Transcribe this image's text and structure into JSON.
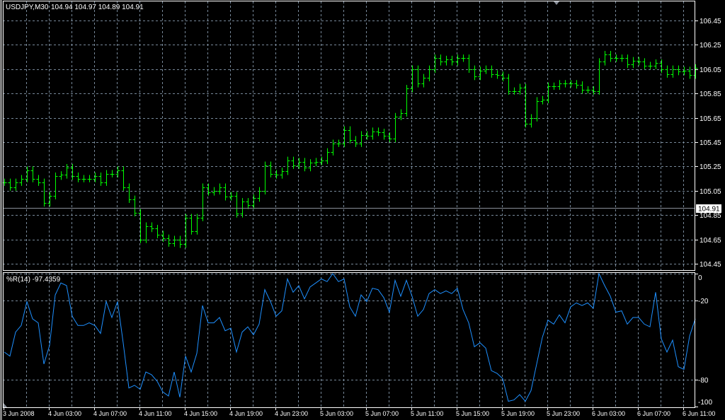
{
  "header": {
    "symbol": "USDJPY,M30",
    "ohlc": "104.94 104.97 104.89 104.91"
  },
  "colors": {
    "background": "#000000",
    "bars": "#00ff00",
    "indicator_line": "#1e90ff",
    "grid": "#778899",
    "frame": "#ffffff"
  },
  "chart_data": [
    {
      "type": "ohlc-bar",
      "title": "USDJPY,M30",
      "current_price_label": "104.91",
      "current_price": 104.91,
      "ylim": [
        104.39,
        106.61
      ],
      "y_ticks": [
        "106.45",
        "106.25",
        "106.05",
        "105.85",
        "105.65",
        "105.45",
        "105.25",
        "105.05",
        "104.85",
        "104.65",
        "104.45"
      ],
      "x_tick_labels": [
        "3 Jun 2008",
        "4 Jun 03:00",
        "4 Jun 07:00",
        "4 Jun 11:00",
        "4 Jun 15:00",
        "4 Jun 19:00",
        "4 Jun 23:00",
        "5 Jun 03:00",
        "5 Jun 07:00",
        "5 Jun 11:00",
        "5 Jun 15:00",
        "5 Jun 19:00",
        "5 Jun 23:00",
        "6 Jun 03:00",
        "6 Jun 07:00",
        "6 Jun 11:00"
      ],
      "grid": true,
      "close": [
        105.12,
        105.08,
        105.12,
        105.15,
        105.22,
        105.15,
        105.12,
        104.95,
        105.01,
        105.17,
        105.18,
        105.24,
        105.17,
        105.15,
        105.15,
        105.15,
        105.17,
        105.12,
        105.19,
        105.19,
        105.22,
        105.08,
        104.98,
        104.87,
        104.65,
        104.76,
        104.74,
        104.69,
        104.66,
        104.62,
        104.65,
        104.61,
        104.83,
        104.72,
        104.83,
        105.08,
        105.04,
        105.05,
        105.08,
        105.0,
        105.01,
        104.86,
        104.96,
        104.93,
        104.99,
        105.05,
        105.26,
        105.19,
        105.18,
        105.21,
        105.3,
        105.26,
        105.29,
        105.24,
        105.28,
        105.29,
        105.3,
        105.37,
        105.44,
        105.44,
        105.55,
        105.47,
        105.44,
        105.51,
        105.5,
        105.54,
        105.53,
        105.5,
        105.48,
        105.66,
        105.69,
        105.89,
        106.05,
        105.93,
        105.98,
        106.05,
        106.14,
        106.11,
        106.13,
        106.11,
        106.14,
        106.14,
        106.05,
        105.99,
        106.04,
        106.05,
        106.01,
        106.0,
        105.98,
        105.87,
        105.87,
        105.9,
        105.6,
        105.65,
        105.79,
        105.8,
        105.91,
        105.91,
        105.93,
        105.93,
        105.93,
        105.92,
        105.88,
        105.88,
        105.87,
        106.11,
        106.17,
        106.14,
        106.14,
        106.14,
        106.09,
        106.12,
        106.11,
        106.08,
        106.08,
        106.1,
        106.05,
        106.01,
        106.05,
        106.03,
        106.04,
        106.0,
        106.06
      ]
    },
    {
      "type": "line",
      "title": "%R(14) -97.4359",
      "ylim": [
        -100,
        0
      ],
      "y_ticks": [
        "0",
        "-20",
        "-80",
        "-100"
      ],
      "grid": true,
      "values": [
        -59,
        -62,
        -44,
        -39,
        -21,
        -34,
        -37,
        -68,
        -54,
        -16,
        -7,
        -9,
        -32,
        -39,
        -39,
        -37,
        -39,
        -45,
        -21,
        -33,
        -21,
        -52,
        -86,
        -84,
        -87,
        -74,
        -76,
        -81,
        -89,
        -92,
        -74,
        -93,
        -62,
        -74,
        -60,
        -24,
        -37,
        -37,
        -33,
        -43,
        -41,
        -59,
        -44,
        -40,
        -46,
        -38,
        -12,
        -21,
        -32,
        -28,
        -4,
        -14,
        -9,
        -19,
        -10,
        -7,
        -4,
        -6,
        0,
        -6,
        -4,
        -25,
        -32,
        -16,
        -21,
        -11,
        -12,
        -18,
        -29,
        -5,
        -17,
        -5,
        -17,
        -32,
        -27,
        -15,
        -12,
        -15,
        -13,
        -15,
        -11,
        -27,
        -37,
        -55,
        -52,
        -56,
        -73,
        -75,
        -79,
        -96,
        -95,
        -91,
        -96,
        -88,
        -68,
        -48,
        -35,
        -38,
        -31,
        -37,
        -25,
        -22,
        -24,
        -22,
        -26,
        0,
        -9,
        -17,
        -29,
        -28,
        -38,
        -33,
        -33,
        -38,
        -40,
        -14,
        -49,
        -59,
        -50,
        -70,
        -72,
        -47,
        -34
      ]
    }
  ]
}
